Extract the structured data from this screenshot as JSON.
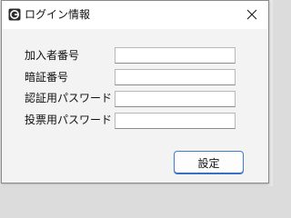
{
  "window": {
    "title": "ログイン情報",
    "icon": "app-icon",
    "close_icon": "close-icon"
  },
  "form": {
    "fields": [
      {
        "label": "加入者番号",
        "value": "",
        "placeholder": ""
      },
      {
        "label": "暗証番号",
        "value": "",
        "placeholder": ""
      },
      {
        "label": "認証用パスワード",
        "value": "",
        "placeholder": ""
      },
      {
        "label": "投票用パスワード",
        "value": "",
        "placeholder": ""
      }
    ]
  },
  "actions": {
    "set_label": "設定"
  },
  "colors": {
    "window_bg": "#f3f3f3",
    "titlebar_bg": "#ffffff",
    "button_border": "#3f7ad1"
  }
}
